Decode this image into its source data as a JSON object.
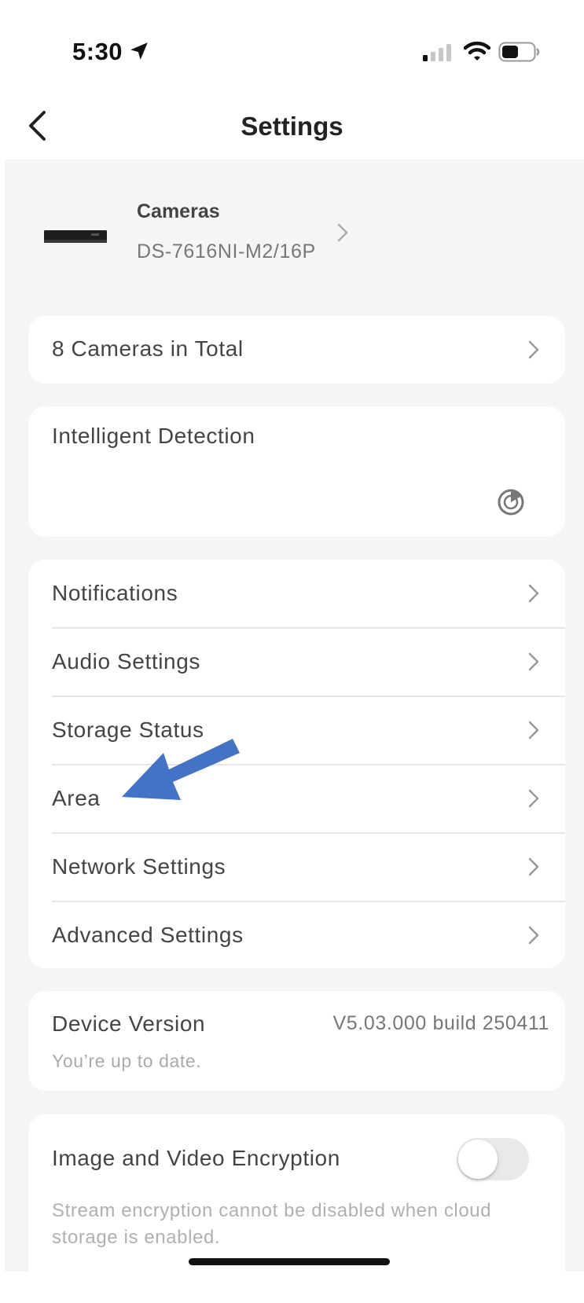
{
  "status_bar": {
    "time": "5:30",
    "icons": [
      "location-arrow-icon",
      "signal-icon",
      "wifi-icon",
      "battery-icon"
    ]
  },
  "nav": {
    "title": "Settings",
    "back_icon": "chevron-left-icon"
  },
  "device": {
    "type": "Cameras",
    "model": "DS-7616NI-M2/16P"
  },
  "cameras_total": {
    "label": "8 Cameras in Total"
  },
  "intelligent_detection": {
    "label": "Intelligent Detection",
    "icon": "radar-icon"
  },
  "settings_list": [
    {
      "label": "Notifications"
    },
    {
      "label": "Audio Settings"
    },
    {
      "label": "Storage Status"
    },
    {
      "label": "Area"
    },
    {
      "label": "Network Settings"
    },
    {
      "label": "Advanced Settings"
    }
  ],
  "device_version": {
    "label": "Device Version",
    "value": "V5.03.000 build 250411",
    "status": "You’re up to date."
  },
  "encryption": {
    "label": "Image and Video Encryption",
    "enabled": false,
    "description": "Stream encryption cannot be disabled when cloud storage is enabled."
  },
  "colors": {
    "background": "#f5f5f5",
    "card": "#ffffff",
    "text_primary": "#444444",
    "text_secondary": "#777777",
    "annotation_arrow": "#4472c4",
    "toggle_off": "#e9e9eb"
  }
}
